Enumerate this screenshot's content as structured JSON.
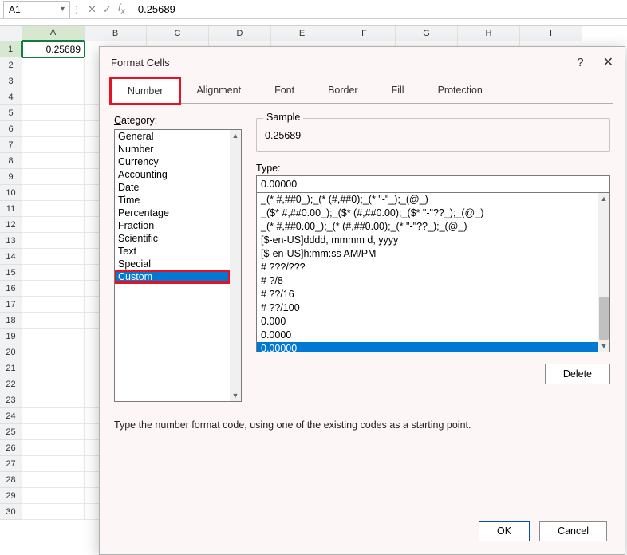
{
  "formula_bar": {
    "name_box": "A1",
    "formula": "0.25689"
  },
  "grid": {
    "columns": [
      "A",
      "B",
      "C",
      "D",
      "E",
      "F",
      "G",
      "H",
      "I"
    ],
    "rows": [
      1,
      2,
      3,
      4,
      5,
      6,
      7,
      8,
      9,
      10,
      11,
      12,
      13,
      14,
      15,
      16,
      17,
      18,
      19,
      20,
      21,
      22,
      23,
      24,
      25,
      26,
      27,
      28,
      29,
      30
    ],
    "selected_cell": {
      "row": 1,
      "col": "A",
      "value": "0.25689"
    }
  },
  "dialog": {
    "title": "Format Cells",
    "tabs": [
      "Number",
      "Alignment",
      "Font",
      "Border",
      "Fill",
      "Protection"
    ],
    "active_tab": "Number",
    "category_label": "Category:",
    "categories": [
      "General",
      "Number",
      "Currency",
      "Accounting",
      "Date",
      "Time",
      "Percentage",
      "Fraction",
      "Scientific",
      "Text",
      "Special",
      "Custom"
    ],
    "selected_category": "Custom",
    "sample_label": "Sample",
    "sample_value": "0.25689",
    "type_label": "Type:",
    "type_value": "0.00000",
    "format_list": [
      "_(* #,##0_);_(* (#,##0);_(* \"-\"_);_(@_)",
      "_($* #,##0.00_);_($* (#,##0.00);_($* \"-\"??_);_(@_)",
      "_(* #,##0.00_);_(* (#,##0.00);_(* \"-\"??_);_(@_)",
      "[$-en-US]dddd, mmmm d, yyyy",
      "[$-en-US]h:mm:ss AM/PM",
      "# ???/???",
      "# ?/8",
      "# ??/16",
      "# ??/100",
      "0.000",
      "0.0000",
      "0.00000"
    ],
    "selected_format": "0.00000",
    "delete_label": "Delete",
    "hint": "Type the number format code, using one of the existing codes as a starting point.",
    "ok_label": "OK",
    "cancel_label": "Cancel"
  }
}
